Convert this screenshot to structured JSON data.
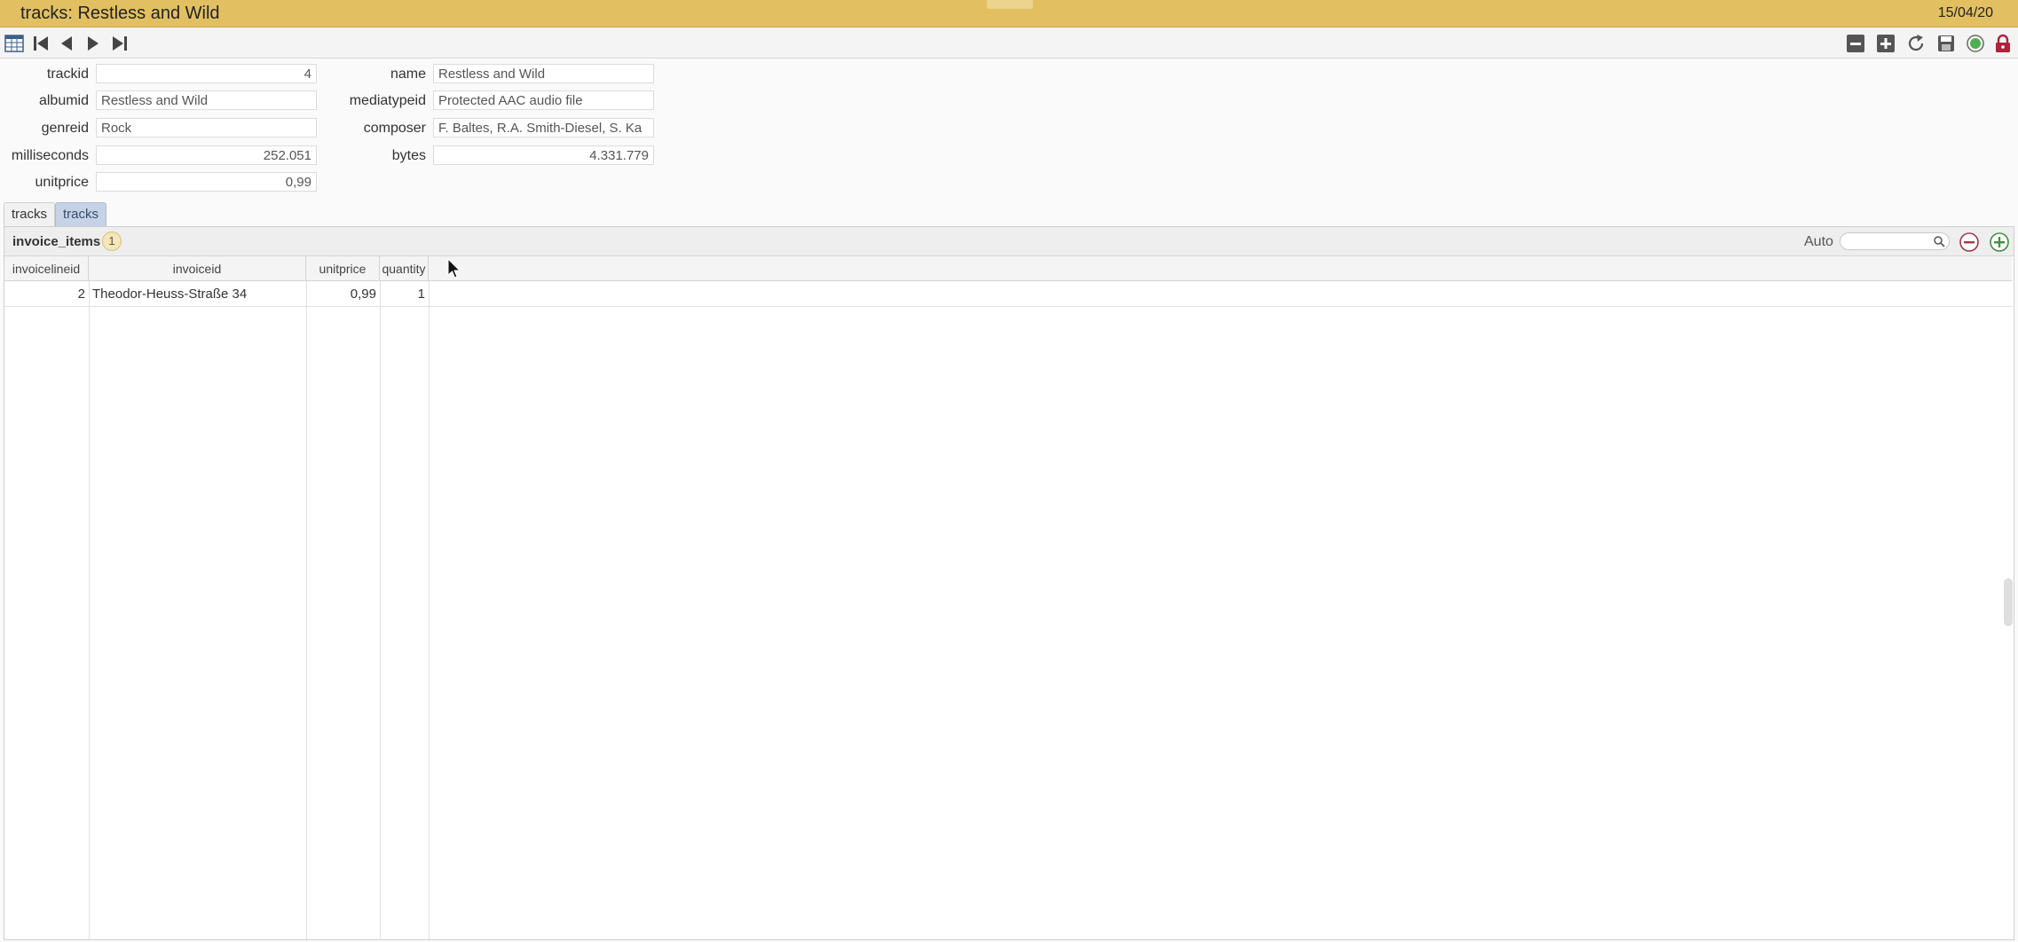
{
  "window": {
    "title": "tracks: Restless and Wild",
    "date": "15/04/20"
  },
  "toolbar": {
    "left_icons": [
      "table-view-icon",
      "first-record-icon",
      "previous-record-icon",
      "next-record-icon",
      "last-record-icon"
    ],
    "right_icons": [
      "delete-record-icon",
      "new-record-icon",
      "refresh-icon",
      "save-icon",
      "status-indicator-icon",
      "lock-icon"
    ],
    "status_color": "#4caf50",
    "lock_color": "#b0213a"
  },
  "form": {
    "trackid": {
      "label": "trackid",
      "value": "4"
    },
    "albumid": {
      "label": "albumid",
      "value": "Restless and Wild"
    },
    "genreid": {
      "label": "genreid",
      "value": "Rock"
    },
    "milliseconds": {
      "label": "milliseconds",
      "value": "252.051"
    },
    "unitprice": {
      "label": "unitprice",
      "value": "0,99"
    },
    "name": {
      "label": "name",
      "value": "Restless and Wild"
    },
    "mediatypeid": {
      "label": "mediatypeid",
      "value": "Protected AAC audio file"
    },
    "composer": {
      "label": "composer",
      "value": "F. Baltes, R.A. Smith-Diesel, S. Ka"
    },
    "bytes": {
      "label": "bytes",
      "value": "4.331.779"
    }
  },
  "tabs": [
    {
      "label": "tracks",
      "active": false
    },
    {
      "label": "tracks",
      "active": true
    }
  ],
  "subform": {
    "title": "invoice_items",
    "count": "1",
    "auto_label": "Auto",
    "search_value": "",
    "columns": [
      "invoicelineid",
      "invoiceid",
      "unitprice",
      "quantity"
    ],
    "rows": [
      {
        "invoicelineid": "2",
        "invoiceid": "Theodor-Heuss-Straße 34",
        "unitprice": "0,99",
        "quantity": "1"
      }
    ]
  }
}
